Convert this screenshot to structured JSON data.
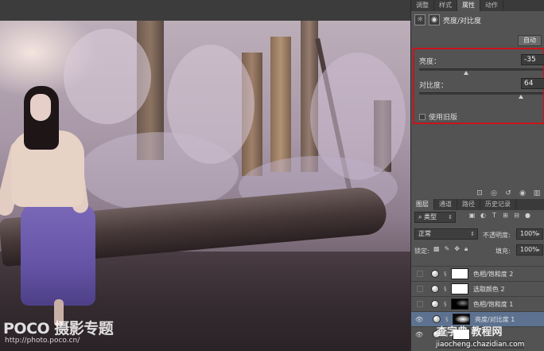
{
  "panel_tabs": {
    "top": [
      "调整",
      "样式",
      "属性",
      "动作"
    ],
    "top_active": 2,
    "layers": [
      "图层",
      "通道",
      "路径",
      "历史记录"
    ],
    "layers_active": 0
  },
  "properties": {
    "title": "亮度/对比度",
    "title_icon": "sun-icon",
    "mask_icon": "mask-icon",
    "auto_label": "自动",
    "brightness_label": "亮度：",
    "brightness_value": "-35",
    "brightness_level_percent": 38,
    "contrast_label": "对比度：",
    "contrast_value": "64",
    "contrast_level_percent": 82,
    "legacy_label": "使用旧版",
    "legacy_checked": false,
    "footer_icons": [
      "clip-icon",
      "eye-view-icon",
      "reset-icon",
      "visibility-icon",
      "trash-icon"
    ]
  },
  "layers_panel": {
    "filter_label": "类型",
    "blend_mode": "正常",
    "opacity_label": "不透明度:",
    "opacity_value": "100%",
    "lock_label": "锁定:",
    "fill_label": "填充:",
    "fill_value": "100%",
    "layers": [
      {
        "name": "色相/饱和度 2",
        "visible": false,
        "mask": "white",
        "selected": false
      },
      {
        "name": "选取颜色 2",
        "visible": false,
        "mask": "white",
        "selected": false
      },
      {
        "name": "色相/饱和度 1",
        "visible": false,
        "mask": "black",
        "selected": false
      },
      {
        "name": "亮度/对比度 1",
        "visible": true,
        "mask": "dark",
        "selected": true
      },
      {
        "name": "",
        "visible": true,
        "mask": "white",
        "selected": false
      }
    ]
  },
  "colors": {
    "highlight_border": "#c9141b",
    "selected_layer": "#5d7290",
    "panel_bg": "#535353"
  },
  "watermarks": {
    "poco": "POCO 摄影专题",
    "poco_url": "http://photo.poco.cn/",
    "site": "查字典 教程网",
    "site_url": "jiaocheng.chazidian.com"
  }
}
